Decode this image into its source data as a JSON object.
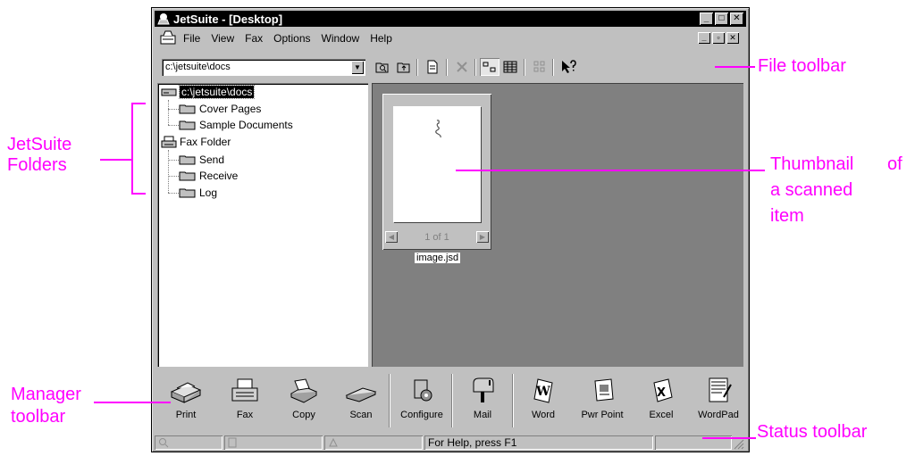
{
  "window": {
    "title": "JetSuite - [Desktop]",
    "menu": [
      "File",
      "View",
      "Fax",
      "Options",
      "Window",
      "Help"
    ]
  },
  "toolbar": {
    "path_value": "c:\\jetsuite\\docs"
  },
  "tree": {
    "root": "c:\\jetsuite\\docs",
    "root_children": [
      "Cover Pages",
      "Sample Documents"
    ],
    "fax": "Fax Folder",
    "fax_children": [
      "Send",
      "Receive",
      "Log"
    ]
  },
  "thumbnail": {
    "page_indicator": "1 of 1",
    "filename": "image.jsd"
  },
  "manager": {
    "buttons": [
      "Print",
      "Fax",
      "Copy",
      "Scan",
      "Configure",
      "Mail",
      "Word",
      "Pwr Point",
      "Excel",
      "WordPad"
    ]
  },
  "status": {
    "help_text": "For Help, press F1"
  },
  "annotations": {
    "file_toolbar": "File toolbar",
    "folders_line1": "JetSuite",
    "folders_line2": "Folders",
    "thumb_line1": "Thumbnail",
    "thumb_line1b": "of",
    "thumb_line2": "a scanned",
    "thumb_line3": "item",
    "manager_line1": "Manager",
    "manager_line2": "toolbar",
    "status_toolbar": "Status toolbar"
  },
  "colors": {
    "annotation": "#ff00ff",
    "face": "#c0c0c0",
    "workspace": "#808080"
  }
}
